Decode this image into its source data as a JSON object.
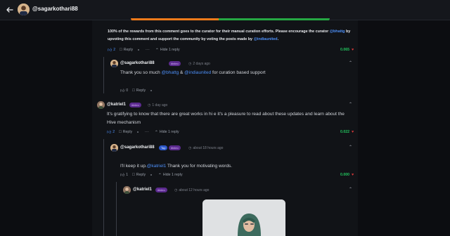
{
  "header": {
    "username": "@sagarkothari88",
    "vote_split": {
      "left_fraction": 0.44
    }
  },
  "curation_comment": {
    "text_1": "100% of the rewards from this comment goes to the curator for their manual curation efforts. Please encourage the curator",
    "link_1": "@bhattg",
    "text_2": "by upvoting this comment and support the community by voting the posts made by",
    "link_2": "@indiaunited",
    "text_3": ".",
    "votes": "2",
    "reply_label": "Reply",
    "hide_label": "Hide 1 reply",
    "payout": "0.065"
  },
  "reply_1": {
    "username": "@sagarkothari88",
    "badge": "#inleo",
    "time": "2 days ago",
    "text_1": "Thank you so much",
    "link_1": "@bhattg",
    "amp": " & ",
    "link_2": "@indiaunited",
    "text_2": " for curation based support",
    "votes": "0",
    "reply_label": "Reply"
  },
  "comment_katriel": {
    "username": "@katriel1",
    "badge": "#inleo",
    "time": "1 day ago",
    "text_1": "It's gratifying to know that there are great works in hi e it's a pleasure to read about these updates and learn",
    "text_2": "about the Hive mechanism",
    "votes": "2",
    "reply_label": "Reply",
    "hide_label": "Hide 1 reply",
    "payout": "0.022"
  },
  "reply_2": {
    "username": "@sagarkothari88",
    "badge_1": "Top",
    "badge_2": "#inleo",
    "time": "about 18 hours ago",
    "text_1": "I'll keep it up.",
    "link_1": "@katriel1",
    "text_2": " Thank you for motivating words.",
    "votes": "1",
    "reply_label": "Reply",
    "hide_label": "Hide 1 reply",
    "payout": "0.000"
  },
  "reply_3": {
    "username": "@katriel1",
    "badge": "#inleo",
    "time": "about 12 hours ago"
  },
  "icons": {
    "back": "arrow-left-icon",
    "upvote": "thumbs-up-icon",
    "reply": "comment-icon",
    "share": "share-icon",
    "more": "more-icon",
    "collapse": "chevron-up-icon",
    "clock": "clock-icon"
  },
  "colors": {
    "link": "#4d8ff7",
    "payout_green": "#22c55e",
    "downvote_red": "#e23b3b",
    "bar_orange": "#f07a1a",
    "bar_green": "#25a843"
  }
}
